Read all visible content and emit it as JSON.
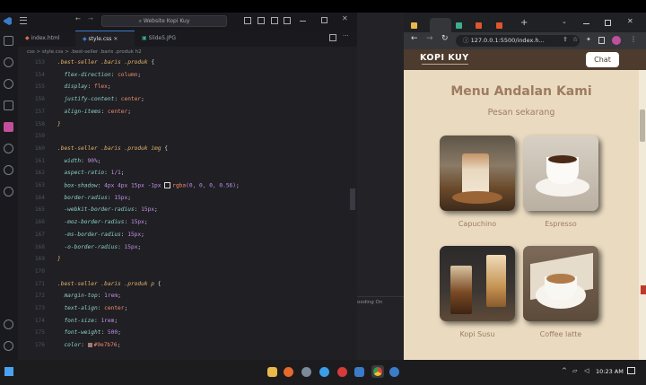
{
  "vscode": {
    "search_text": "Website Kopi Kuy",
    "tabs": [
      {
        "label": "index.html"
      },
      {
        "label": "style.css"
      },
      {
        "label": "Slide5.JPG"
      }
    ],
    "breadcrumb": "css > style.css > .best-seller .baris .produk h2",
    "code_lines": [
      {
        "n": "153",
        "t": [
          [
            ".best-seller .baris .produk",
            "sel"
          ],
          [
            " {",
            "pun"
          ]
        ]
      },
      {
        "n": "154",
        "t": [
          [
            "  flex-direction",
            "prop"
          ],
          [
            ": ",
            "pun"
          ],
          [
            "column",
            "val"
          ],
          [
            ";",
            "pun"
          ]
        ]
      },
      {
        "n": "155",
        "t": [
          [
            "  display",
            "prop"
          ],
          [
            ": ",
            "pun"
          ],
          [
            "flex",
            "val"
          ],
          [
            ";",
            "pun"
          ]
        ]
      },
      {
        "n": "156",
        "t": [
          [
            "  justify-content",
            "prop"
          ],
          [
            ": ",
            "pun"
          ],
          [
            "center",
            "val"
          ],
          [
            ";",
            "pun"
          ]
        ]
      },
      {
        "n": "157",
        "t": [
          [
            "  align-items",
            "prop"
          ],
          [
            ": ",
            "pun"
          ],
          [
            "center",
            "val"
          ],
          [
            ";",
            "pun"
          ]
        ]
      },
      {
        "n": "158",
        "t": [
          [
            "}",
            "sel"
          ]
        ]
      },
      {
        "n": "159",
        "t": []
      },
      {
        "n": "160",
        "t": [
          [
            ".best-seller .baris .produk img",
            "sel"
          ],
          [
            " {",
            "pun"
          ]
        ]
      },
      {
        "n": "161",
        "t": [
          [
            "  width",
            "prop"
          ],
          [
            ": ",
            "pun"
          ],
          [
            "90%",
            "num"
          ],
          [
            ";",
            "pun"
          ]
        ]
      },
      {
        "n": "162",
        "t": [
          [
            "  aspect-ratio",
            "prop"
          ],
          [
            ": ",
            "pun"
          ],
          [
            "1/1",
            "num"
          ],
          [
            ";",
            "pun"
          ]
        ]
      },
      {
        "n": "163",
        "t": [
          [
            "  box-shadow",
            "prop"
          ],
          [
            ": ",
            "pun"
          ],
          [
            "4px 4px 15px -1px ",
            "num"
          ],
          [
            "rgba",
            "val"
          ],
          [
            "(0, 0, 0, 0.56)",
            "num"
          ],
          [
            ";",
            "pun"
          ]
        ]
      },
      {
        "n": "164",
        "t": [
          [
            "  border-radius",
            "prop"
          ],
          [
            ": ",
            "pun"
          ],
          [
            "15px",
            "num"
          ],
          [
            ";",
            "pun"
          ]
        ]
      },
      {
        "n": "165",
        "t": [
          [
            "  -webkit-border-radius",
            "prop"
          ],
          [
            ": ",
            "pun"
          ],
          [
            "15px",
            "num"
          ],
          [
            ";",
            "pun"
          ]
        ]
      },
      {
        "n": "166",
        "t": [
          [
            "  -moz-border-radius",
            "prop"
          ],
          [
            ": ",
            "pun"
          ],
          [
            "15px",
            "num"
          ],
          [
            ";",
            "pun"
          ]
        ]
      },
      {
        "n": "167",
        "t": [
          [
            "  -ms-border-radius",
            "prop"
          ],
          [
            ": ",
            "pun"
          ],
          [
            "15px",
            "num"
          ],
          [
            ";",
            "pun"
          ]
        ]
      },
      {
        "n": "168",
        "t": [
          [
            "  -o-border-radius",
            "prop"
          ],
          [
            ": ",
            "pun"
          ],
          [
            "15px",
            "num"
          ],
          [
            ";",
            "pun"
          ]
        ]
      },
      {
        "n": "169",
        "t": [
          [
            "}",
            "sel"
          ]
        ]
      },
      {
        "n": "170",
        "t": []
      },
      {
        "n": "171",
        "t": [
          [
            ".best-seller .baris .produk p",
            "sel"
          ],
          [
            " {",
            "pun"
          ]
        ]
      },
      {
        "n": "172",
        "t": [
          [
            "  margin-top",
            "prop"
          ],
          [
            ": ",
            "pun"
          ],
          [
            "1rem",
            "num"
          ],
          [
            ";",
            "pun"
          ]
        ]
      },
      {
        "n": "173",
        "t": [
          [
            "  text-align",
            "prop"
          ],
          [
            ": ",
            "pun"
          ],
          [
            "center",
            "val"
          ],
          [
            ";",
            "pun"
          ]
        ]
      },
      {
        "n": "174",
        "t": [
          [
            "  font-size",
            "prop"
          ],
          [
            ": ",
            "pun"
          ],
          [
            "1rem",
            "num"
          ],
          [
            ";",
            "pun"
          ]
        ]
      },
      {
        "n": "175",
        "t": [
          [
            "  font-weight",
            "prop"
          ],
          [
            ": ",
            "pun"
          ],
          [
            "500",
            "num"
          ],
          [
            ";",
            "pun"
          ]
        ]
      },
      {
        "n": "176",
        "t": [
          [
            "  color",
            "prop"
          ],
          [
            ": ",
            "pun"
          ],
          [
            "#9e7b76",
            "val"
          ],
          [
            ";",
            "pun"
          ]
        ]
      }
    ],
    "panel_text": "ooding On"
  },
  "browser": {
    "address": "127.0.0.1:5500/index.h...",
    "nav_logo": "KOPI KUY",
    "chat_label": "Chat",
    "heading": "Menu Andalan Kami",
    "subheading": "Pesan sekarang",
    "products": [
      {
        "name": "Capuchino"
      },
      {
        "name": "Espresso"
      },
      {
        "name": "Kopi Susu"
      },
      {
        "name": "Coffee latte"
      }
    ]
  },
  "taskbar": {
    "time": "10:23 AM"
  },
  "colors": {
    "heading": "#9e7b61",
    "page_bg": "#eadbc0",
    "nav_bg": "#4d3b2e",
    "accent_blue": "#3b7cc9"
  }
}
